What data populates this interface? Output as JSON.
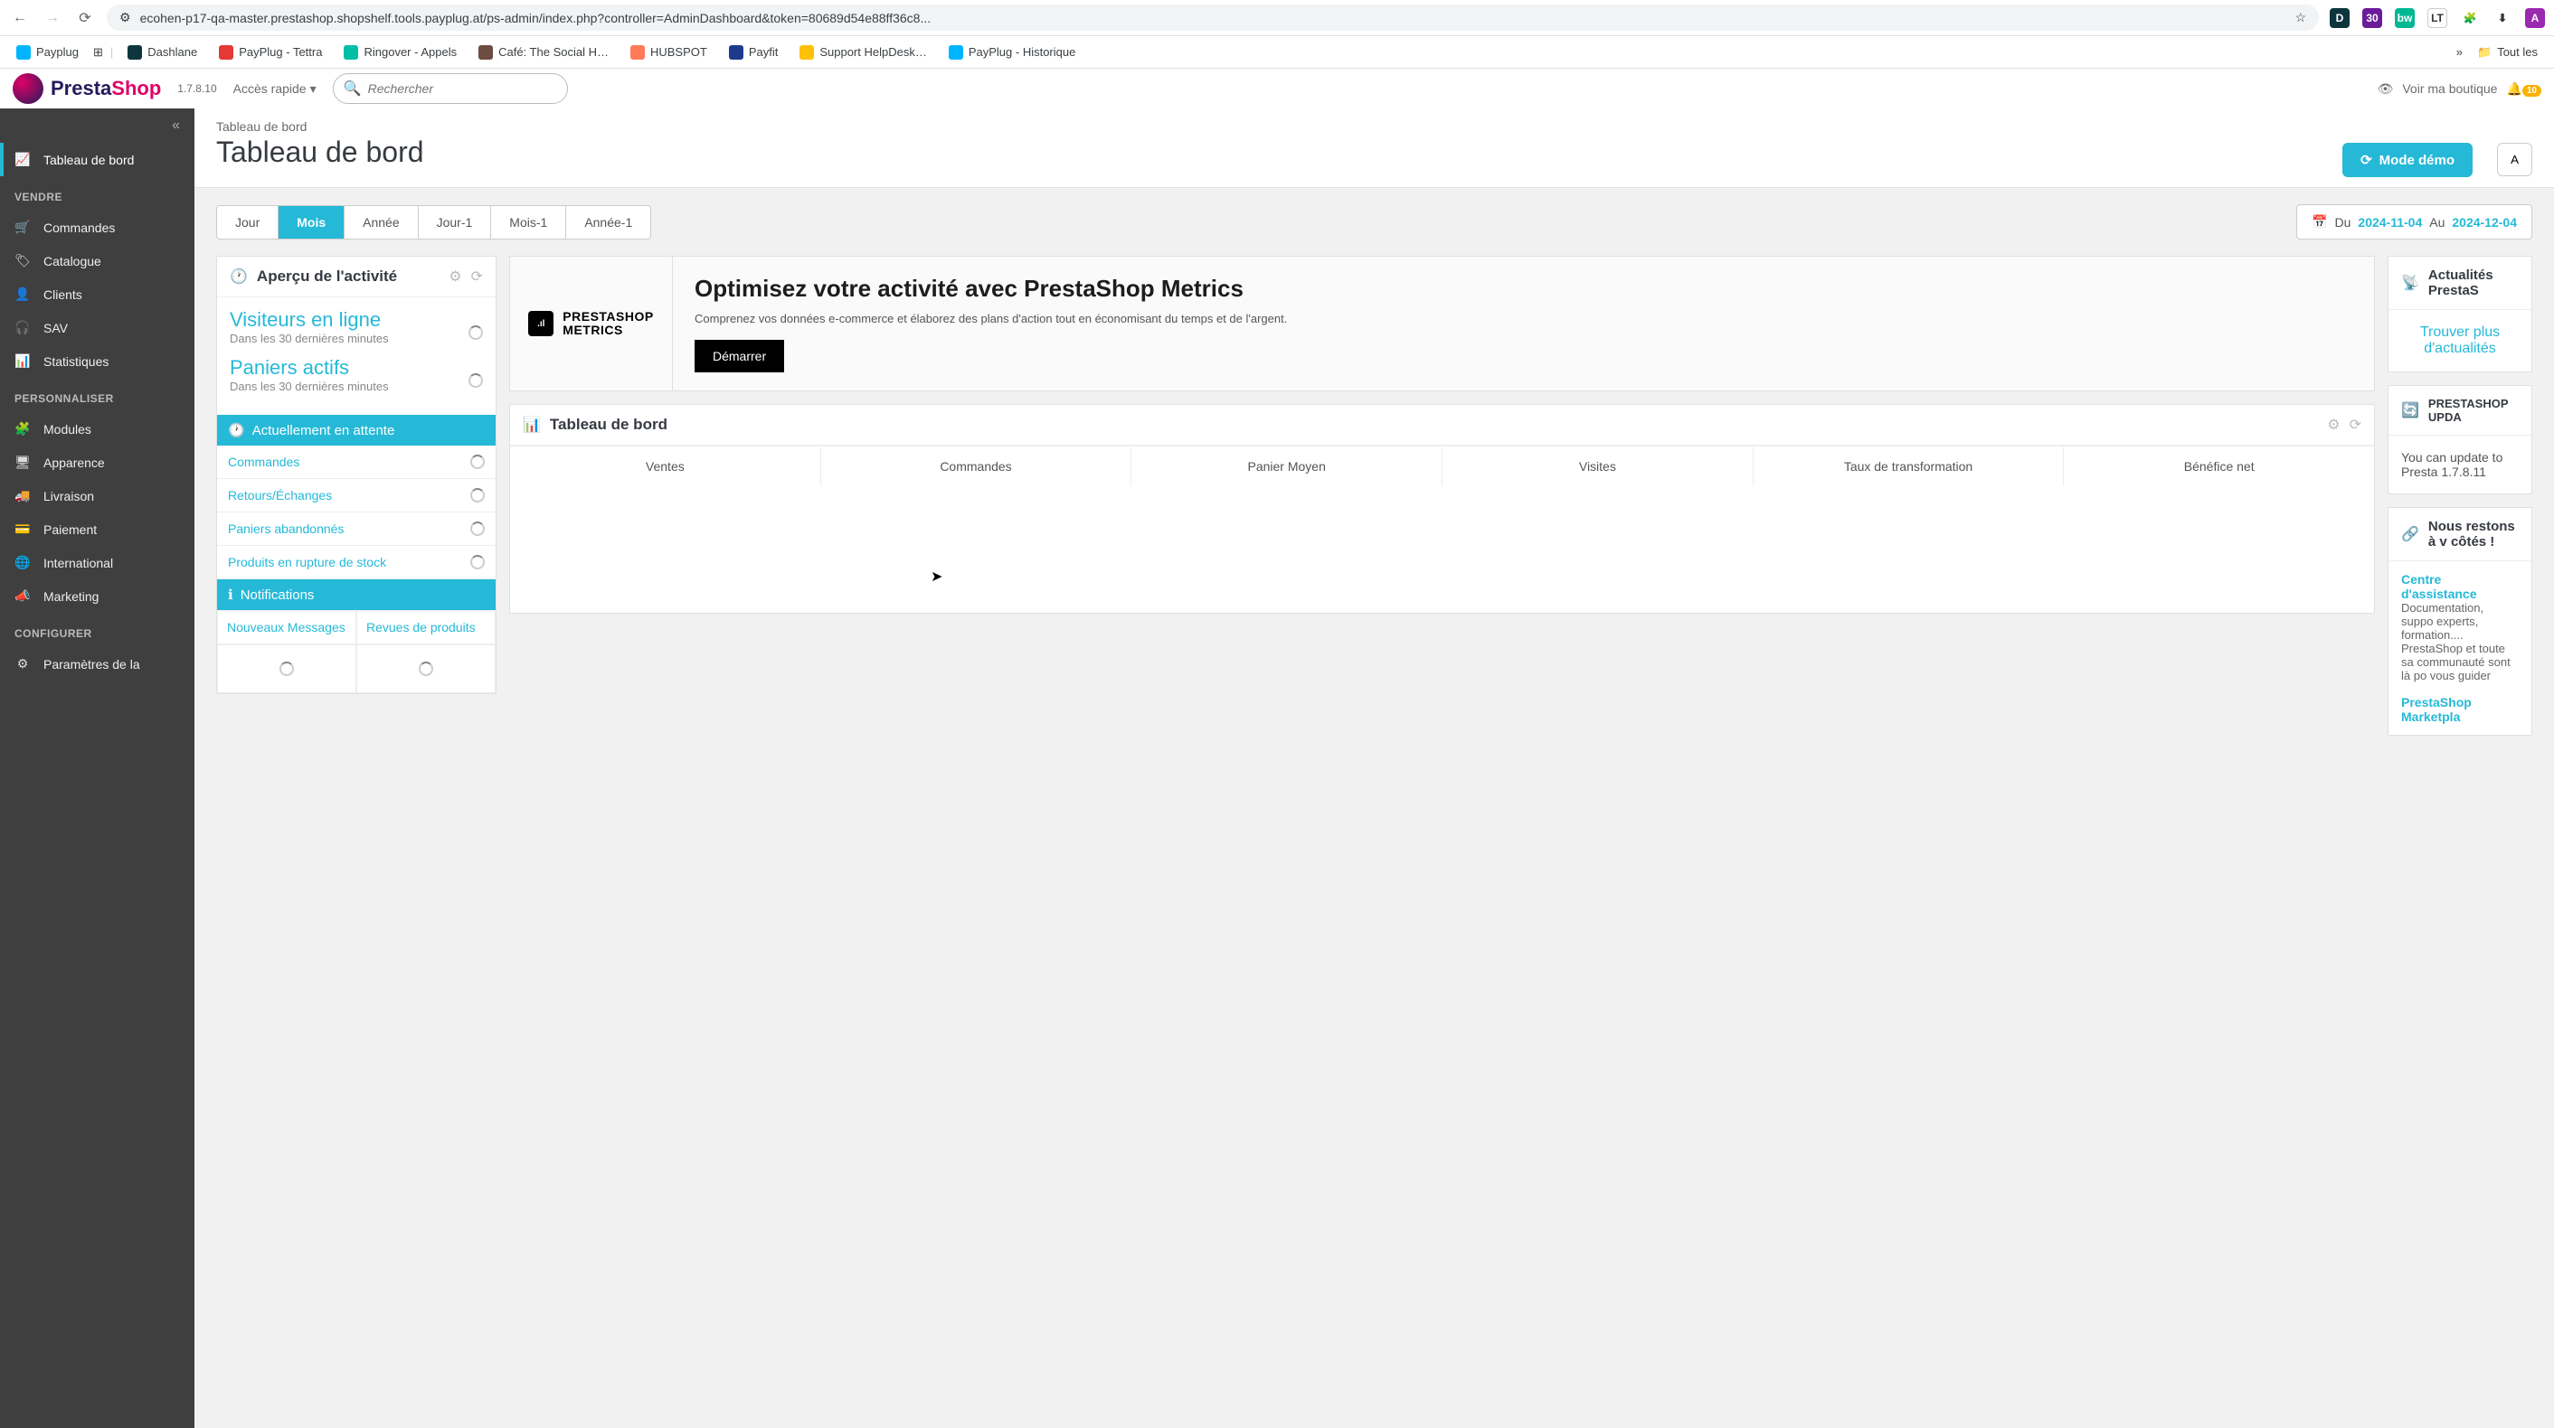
{
  "browser": {
    "url": "ecohen-p17-qa-master.prestashop.shopshelf.tools.payplug.at/ps-admin/index.php?controller=AdminDashboard&token=80689d54e88ff36c8...",
    "bookmarks": [
      {
        "label": "Payplug",
        "color": "#00b4ff"
      },
      {
        "label": "Dashlane",
        "color": "#0e353d"
      },
      {
        "label": "PayPlug - Tettra",
        "color": "#e53935"
      },
      {
        "label": "Ringover - Appels",
        "color": "#00bfa5"
      },
      {
        "label": "Café: The Social H…",
        "color": "#6d4c41"
      },
      {
        "label": "HUBSPOT",
        "color": "#ff7a59"
      },
      {
        "label": "Payfit",
        "color": "#1e3a8a"
      },
      {
        "label": "Support HelpDesk…",
        "color": "#ffc107"
      },
      {
        "label": "PayPlug - Historique",
        "color": "#00b4ff"
      }
    ],
    "all_bookmarks": "Tout les"
  },
  "app": {
    "logo_presta": "Presta",
    "logo_shop": "Shop",
    "version": "1.7.8.10",
    "quick_access": "Accès rapide",
    "search_placeholder": "Rechercher",
    "view_shop": "Voir ma boutique",
    "notif_count": "10"
  },
  "sidebar": {
    "dashboard": "Tableau de bord",
    "section_sell": "VENDRE",
    "orders": "Commandes",
    "catalog": "Catalogue",
    "customers": "Clients",
    "sav": "SAV",
    "stats": "Statistiques",
    "section_personalize": "PERSONNALISER",
    "modules": "Modules",
    "appearance": "Apparence",
    "delivery": "Livraison",
    "payment": "Paiement",
    "international": "International",
    "marketing": "Marketing",
    "section_configure": "CONFIGURER",
    "shop_params": "Paramètres de la"
  },
  "page": {
    "breadcrumb": "Tableau de bord",
    "title": "Tableau de bord",
    "demo_mode": "Mode démo",
    "add": "A"
  },
  "periods": {
    "day": "Jour",
    "month": "Mois",
    "year": "Année",
    "day_1": "Jour-1",
    "month_1": "Mois-1",
    "year_1": "Année-1"
  },
  "date_range": {
    "from_label": "Du",
    "from": "2024-11-04",
    "to_label": "Au",
    "to": "2024-12-04"
  },
  "activity": {
    "title": "Aperçu de l'activité",
    "visitors_title": "Visiteurs en ligne",
    "visitors_sub": "Dans les 30 dernières minutes",
    "carts_title": "Paniers actifs",
    "carts_sub": "Dans les 30 dernières minutes",
    "pending_header": "Actuellement en attente",
    "pending": {
      "orders": "Commandes",
      "returns": "Retours/Échanges",
      "abandoned": "Paniers abandonnés",
      "out_of_stock": "Produits en rupture de stock"
    },
    "notif_header": "Notifications",
    "notif_tabs": {
      "messages": "Nouveaux Messages",
      "reviews": "Revues de produits"
    }
  },
  "metrics": {
    "logo_line1": "PRESTASHOP",
    "logo_line2": "METRICS",
    "title": "Optimisez votre activité avec PrestaShop Metrics",
    "desc": "Comprenez vos données e-commerce et élaborez des plans d'action tout en économisant du temps et de l'argent.",
    "cta": "Démarrer"
  },
  "dashboard_panel": {
    "title": "Tableau de bord",
    "tabs": {
      "sales": "Ventes",
      "orders": "Commandes",
      "avg_cart": "Panier Moyen",
      "visits": "Visites",
      "conversion": "Taux de transformation",
      "profit": "Bénéfice net"
    }
  },
  "news": {
    "title": "Actualités PrestaS",
    "link": "Trouver plus d'actualités"
  },
  "upgrade": {
    "title": "PRESTASHOP UPDA",
    "text": "You can update to Presta 1.7.8.11"
  },
  "help": {
    "title": "Nous restons à v côtés !",
    "center_title": "Centre d'assistance",
    "center_desc": "Documentation, suppo experts, formation.... PrestaShop et toute sa communauté sont là po vous guider",
    "marketplace": "PrestaShop Marketpla"
  }
}
